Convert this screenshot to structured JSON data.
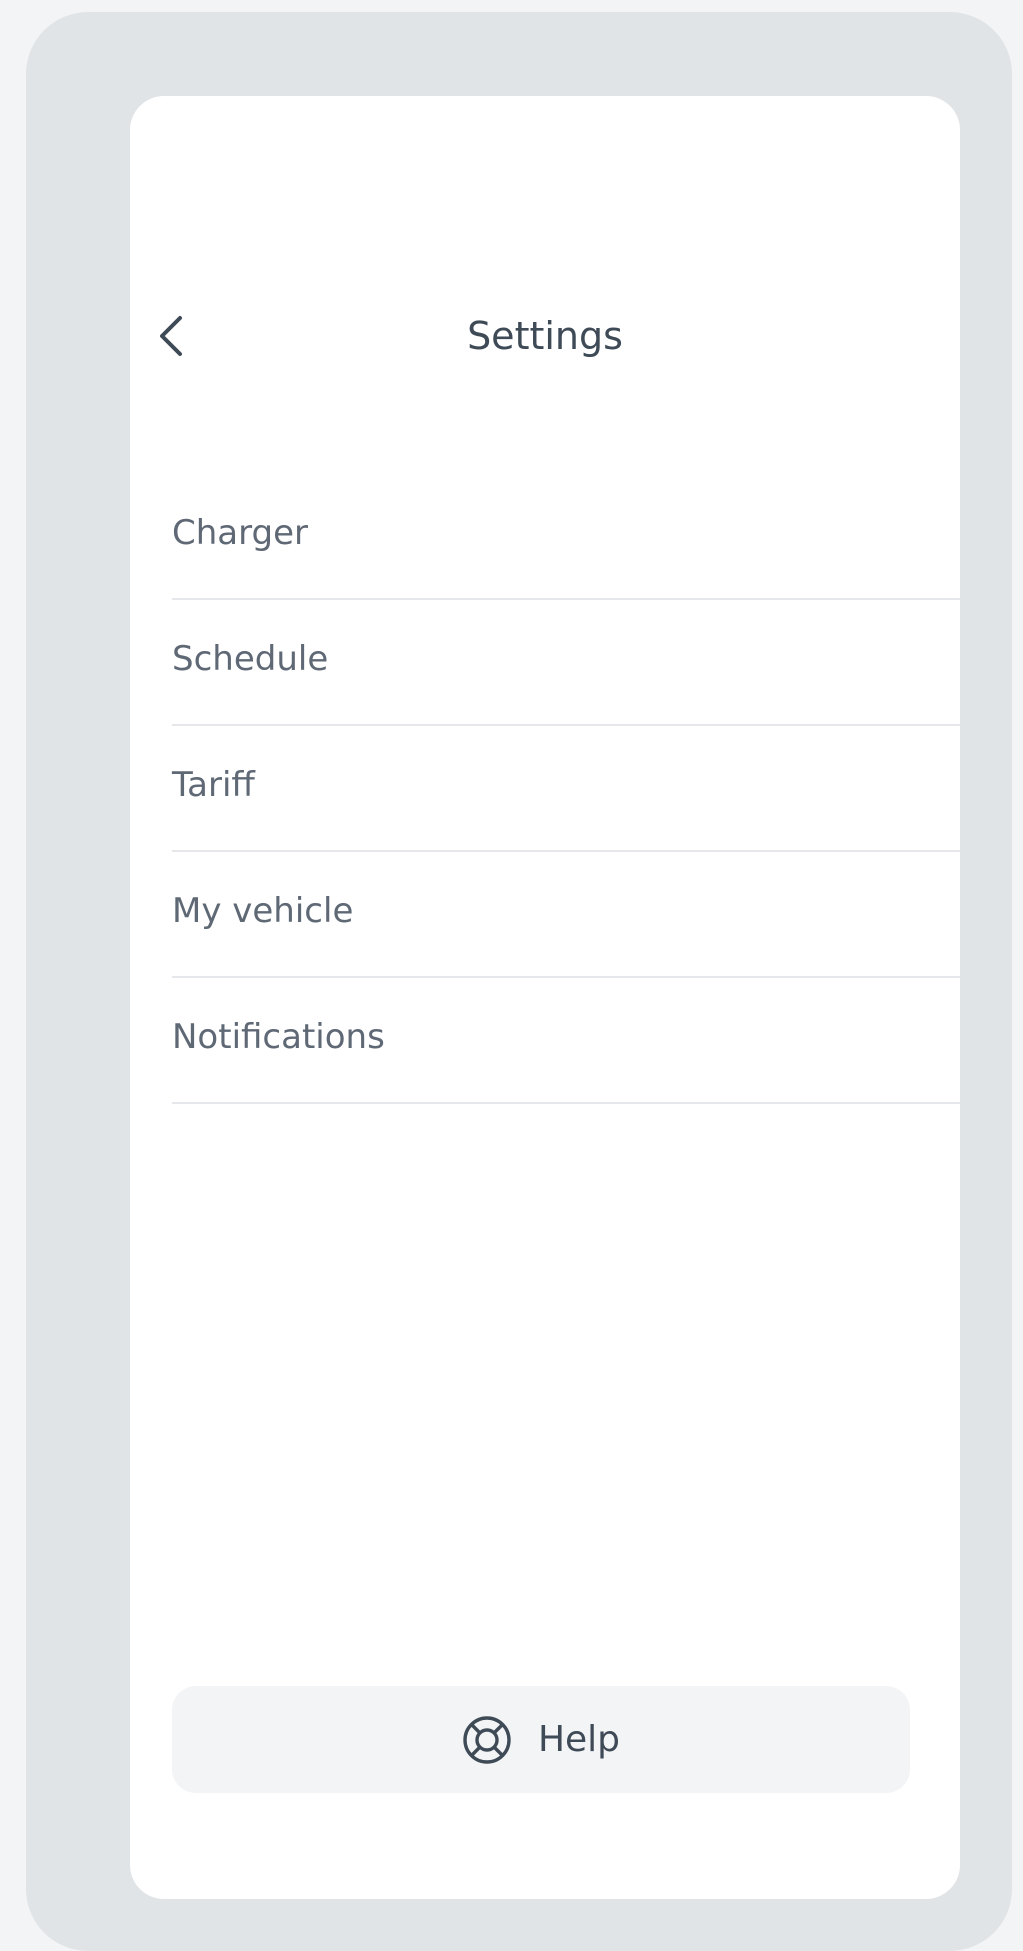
{
  "header": {
    "title": "Settings",
    "back_icon": "chevron-left-icon"
  },
  "menu": {
    "items": [
      {
        "label": "Charger"
      },
      {
        "label": "Schedule"
      },
      {
        "label": "Tariff"
      },
      {
        "label": "My vehicle"
      },
      {
        "label": "Notifications"
      }
    ]
  },
  "help": {
    "label": "Help",
    "icon": "lifebuoy-icon"
  },
  "colors": {
    "page_background": "#f3f4f6",
    "device_frame": "#e1e4e7",
    "screen_background": "#ffffff",
    "title_text": "#3f4a57",
    "menu_text": "#5f6875",
    "divider": "#e5e7ea",
    "help_background": "#f3f4f6"
  }
}
